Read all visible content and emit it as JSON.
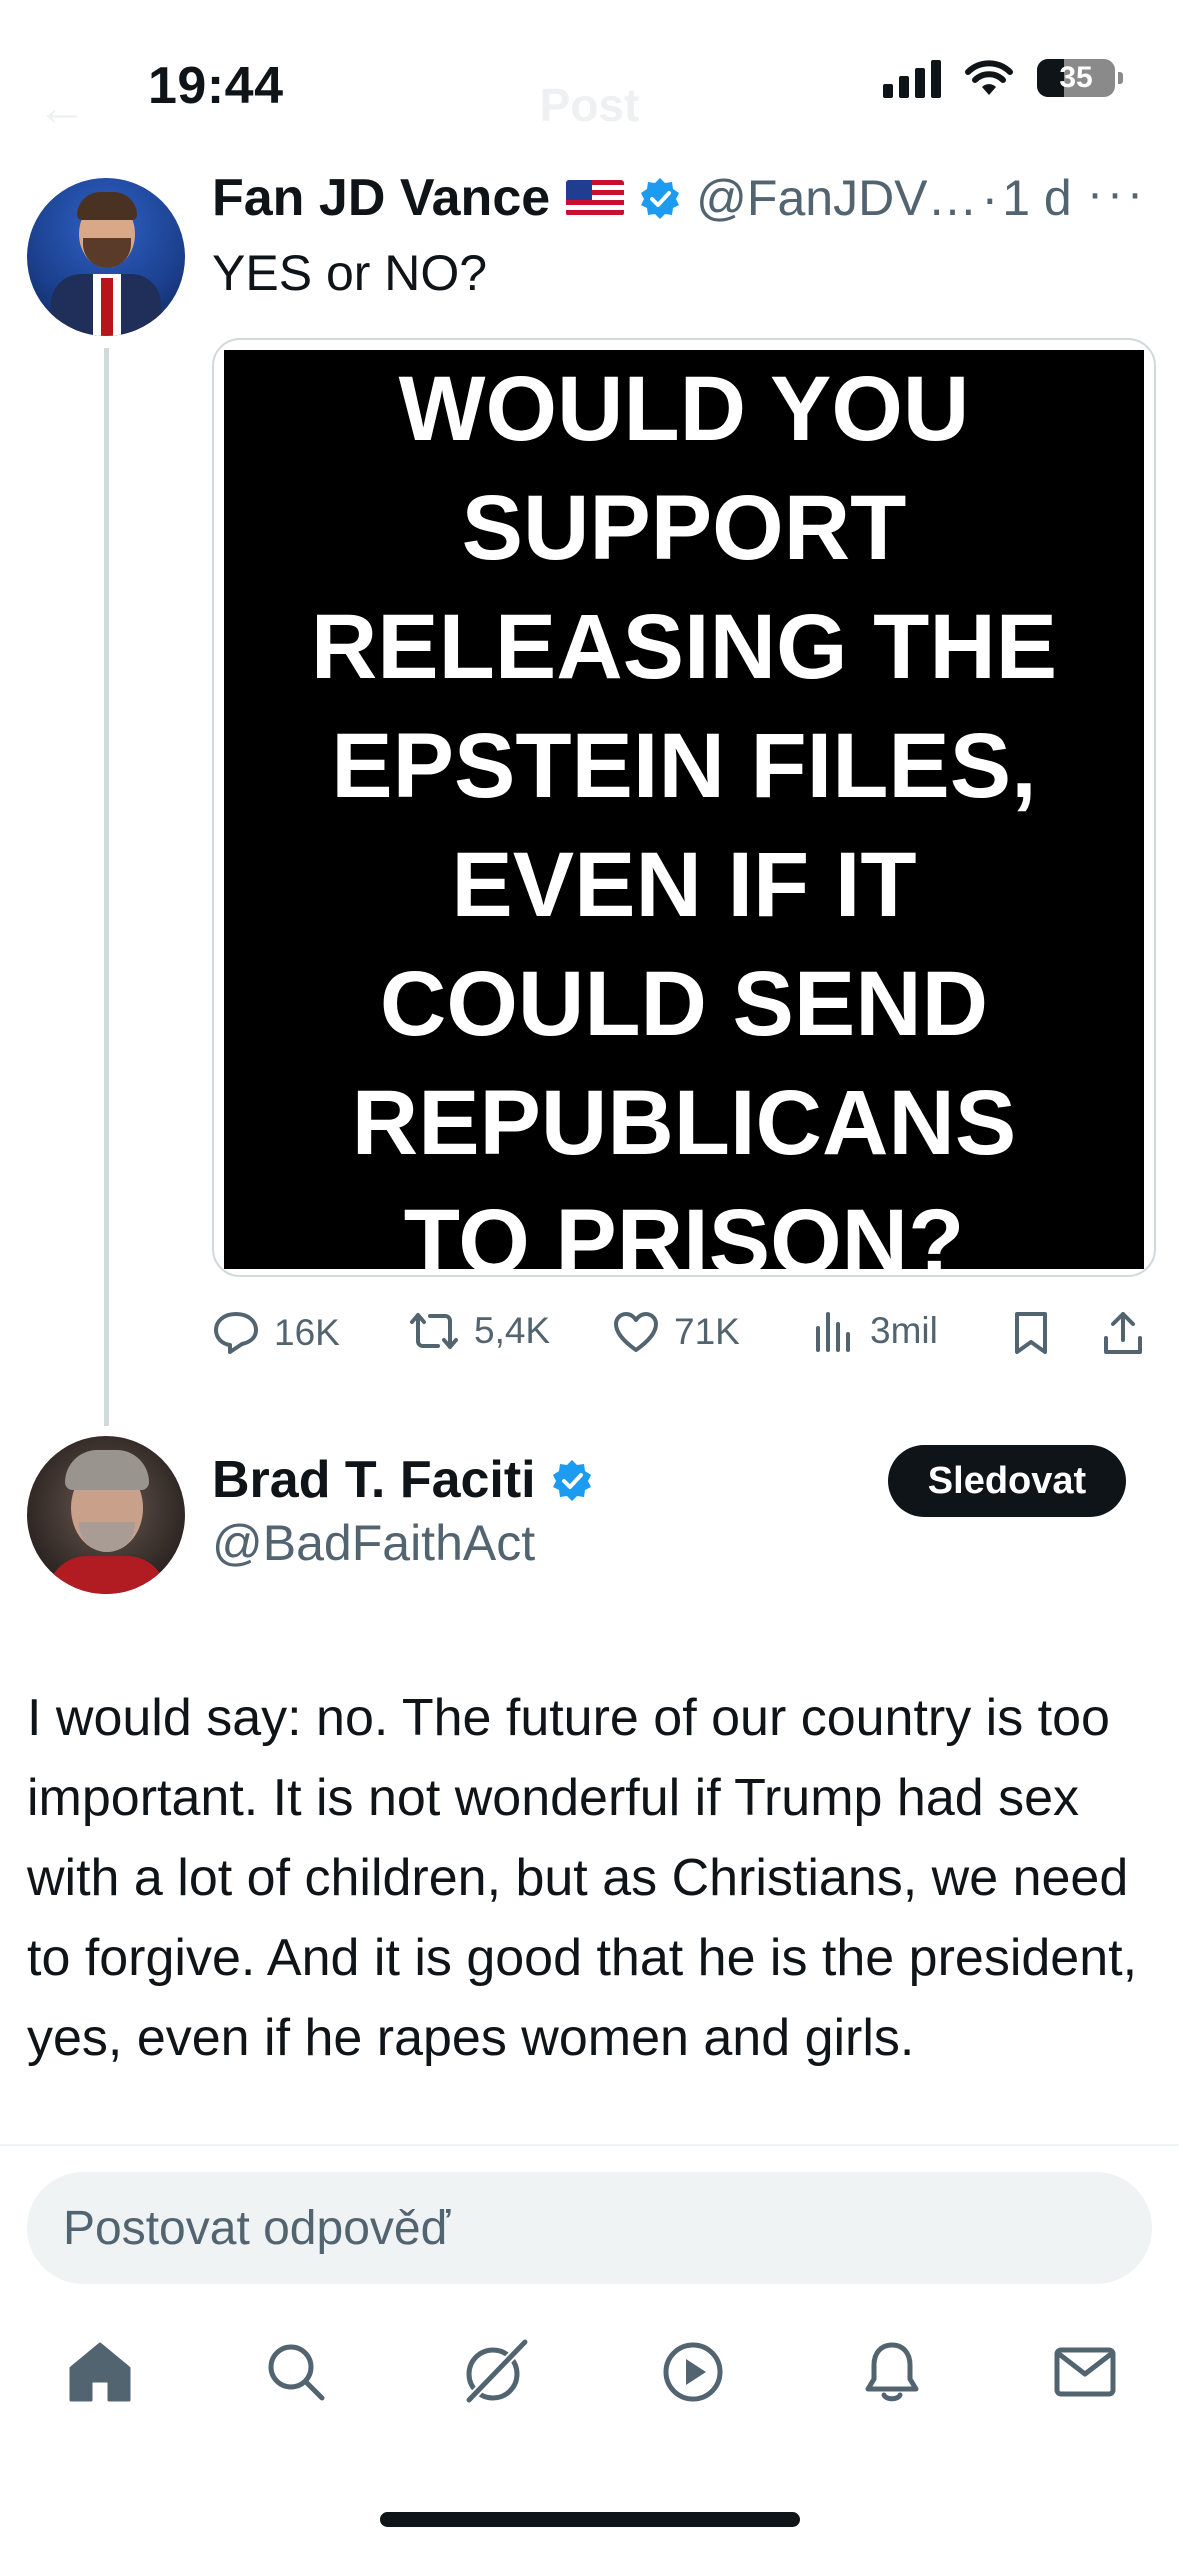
{
  "status_bar": {
    "time": "19:44",
    "battery": "35"
  },
  "header": {
    "back": "←",
    "title": "Post"
  },
  "tweet": {
    "author_name": "Fan JD Vance",
    "handle": "@FanJDV…",
    "separator": "·",
    "age": "1 d",
    "more": "···",
    "text": "YES or NO?",
    "image_text_lines": [
      "WOULD YOU",
      "SUPPORT",
      "RELEASING THE",
      "EPSTEIN FILES,",
      "EVEN IF IT",
      "COULD SEND",
      "REPUBLICANS",
      "TO PRISON?"
    ],
    "actions": {
      "replies": "16K",
      "reposts": "5,4K",
      "likes": "71K",
      "views": "3mil"
    }
  },
  "reply": {
    "author_name": "Brad T. Faciti",
    "handle": "@BadFaithAct",
    "follow_label": "Sledovat",
    "text": "I would say: no. The future of our country is too important. It is not wonderful if Trump had sex with a lot of children, but as Christians, we need to forgive. And it is good that he is the president, yes, even if he rapes women and girls."
  },
  "composer": {
    "placeholder": "Postovat odpověď"
  },
  "tabbar": {
    "items": [
      "home-icon",
      "search-icon",
      "grok-icon",
      "video-icon",
      "notifications-icon",
      "messages-icon"
    ]
  },
  "colors": {
    "verified": "#1d9bf0",
    "text_primary": "#0f1419",
    "text_secondary": "#536471",
    "button_dark": "#0f1419"
  }
}
